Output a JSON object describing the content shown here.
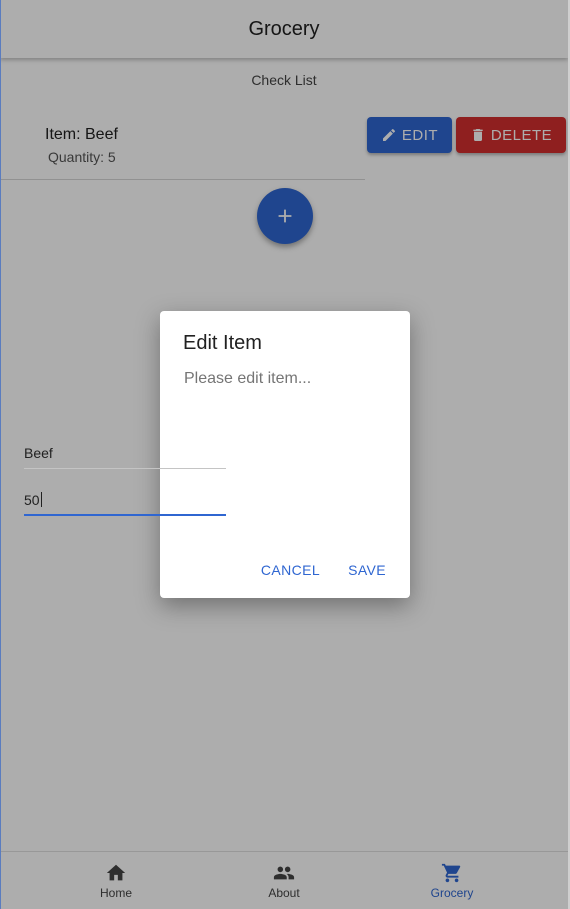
{
  "header": {
    "title": "Grocery"
  },
  "list": {
    "subtitle": "Check List",
    "items": [
      {
        "name": "Item: Beef",
        "quantity": "Quantity: 5"
      }
    ],
    "edit_label": "Edit",
    "delete_label": "Delete"
  },
  "dialog": {
    "title": "Edit Item",
    "text": "Please edit item...",
    "name_value": "Beef",
    "quantity_value": "50",
    "cancel_label": "CANCEL",
    "save_label": "SAVE"
  },
  "bottom_nav": {
    "items": [
      {
        "label": "Home",
        "icon": "home-icon",
        "active": false
      },
      {
        "label": "About",
        "icon": "people-icon",
        "active": false
      },
      {
        "label": "Grocery",
        "icon": "cart-icon",
        "active": true
      }
    ]
  },
  "colors": {
    "primary": "#2f66d1",
    "danger": "#d32f2f"
  }
}
